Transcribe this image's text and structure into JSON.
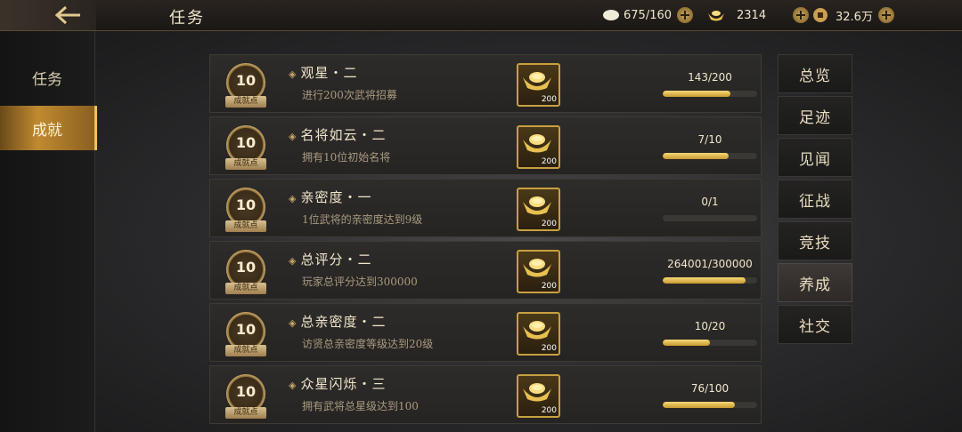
{
  "header": {
    "title": "任务",
    "resources": [
      {
        "name": "stamina",
        "icon": "pill-icon",
        "value": "675/160"
      },
      {
        "name": "gold",
        "icon": "gold-ingot-icon",
        "value": "2314"
      },
      {
        "name": "coins",
        "icon": "coin-icon",
        "value": "32.6万"
      }
    ]
  },
  "left_tabs": [
    {
      "label": "任务",
      "active": false
    },
    {
      "label": "成就",
      "active": true
    }
  ],
  "tasks": [
    {
      "points": "10",
      "points_label": "成就点",
      "title": "观星・二",
      "desc": "进行200次武将招募",
      "reward_qty": "200",
      "progress_text": "143/200",
      "progress": 0.715
    },
    {
      "points": "10",
      "points_label": "成就点",
      "title": "名将如云・二",
      "desc": "拥有10位初始名将",
      "reward_qty": "200",
      "progress_text": "7/10",
      "progress": 0.7
    },
    {
      "points": "10",
      "points_label": "成就点",
      "title": "亲密度・一",
      "desc": "1位武将的亲密度达到9级",
      "reward_qty": "200",
      "progress_text": "0/1",
      "progress": 0
    },
    {
      "points": "10",
      "points_label": "成就点",
      "title": "总评分・二",
      "desc": "玩家总评分达到300000",
      "reward_qty": "200",
      "progress_text": "264001/300000",
      "progress": 0.88
    },
    {
      "points": "10",
      "points_label": "成就点",
      "title": "总亲密度・二",
      "desc": "访贤总亲密度等级达到20级",
      "reward_qty": "200",
      "progress_text": "10/20",
      "progress": 0.5
    },
    {
      "points": "10",
      "points_label": "成就点",
      "title": "众星闪烁・三",
      "desc": "拥有武将总星级达到100",
      "reward_qty": "200",
      "progress_text": "76/100",
      "progress": 0.76
    }
  ],
  "categories": [
    {
      "label": "总览",
      "active": false
    },
    {
      "label": "足迹",
      "active": false
    },
    {
      "label": "见闻",
      "active": false
    },
    {
      "label": "征战",
      "active": false
    },
    {
      "label": "竞技",
      "active": false
    },
    {
      "label": "养成",
      "active": true
    },
    {
      "label": "社交",
      "active": false
    }
  ],
  "colors": {
    "accent": "#c9a040",
    "progress": "#e8c050",
    "active_tab": "#c08a30"
  }
}
